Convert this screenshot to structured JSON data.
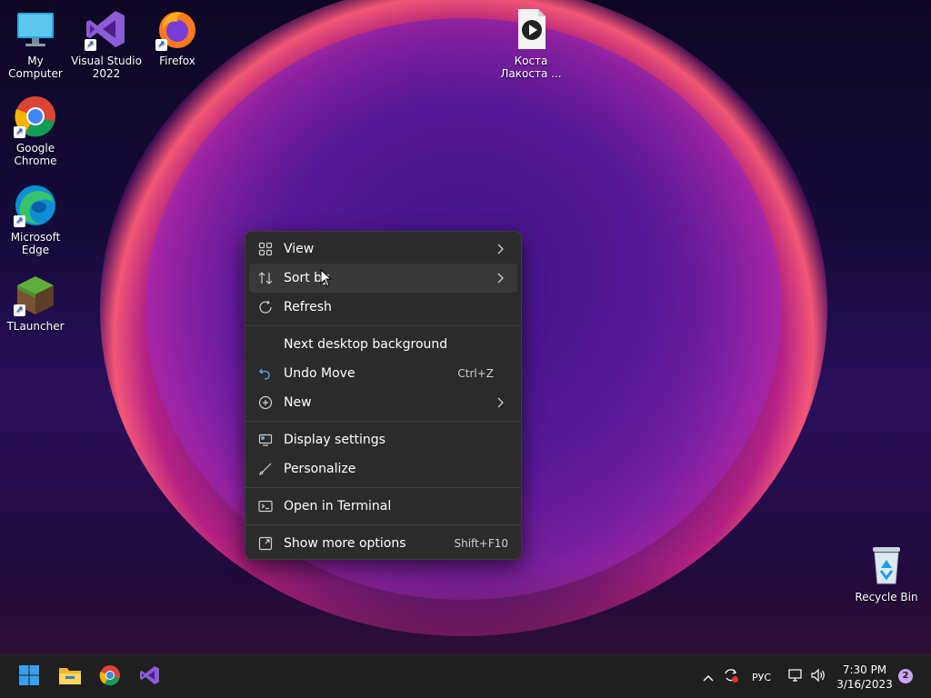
{
  "desktop": {
    "icons": [
      {
        "label": "My Computer",
        "icon": "monitor-icon"
      },
      {
        "label": "Visual Studio 2022",
        "icon": "visual-studio-icon"
      },
      {
        "label": "Firefox",
        "icon": "firefox-icon"
      },
      {
        "label": "Коста Лакоста ...",
        "icon": "media-file-icon"
      },
      {
        "label": "Google Chrome",
        "icon": "chrome-icon"
      },
      {
        "label": "Microsoft Edge",
        "icon": "edge-icon"
      },
      {
        "label": "TLauncher",
        "icon": "minecraft-block-icon"
      },
      {
        "label": "Recycle Bin",
        "icon": "recycle-bin-icon"
      }
    ]
  },
  "context_menu": {
    "items": [
      {
        "label": "View",
        "icon": "grid-icon",
        "submenu": true
      },
      {
        "label": "Sort by",
        "icon": "sort-icon",
        "submenu": true,
        "hovered": true
      },
      {
        "label": "Refresh",
        "icon": "refresh-icon"
      },
      {
        "label": "Next desktop background",
        "icon": ""
      },
      {
        "label": "Undo Move",
        "icon": "undo-icon",
        "shortcut": "Ctrl+Z"
      },
      {
        "label": "New",
        "icon": "plus-circle-icon",
        "submenu": true
      },
      {
        "label": "Display settings",
        "icon": "display-icon"
      },
      {
        "label": "Personalize",
        "icon": "brush-icon"
      },
      {
        "label": "Open in Terminal",
        "icon": "terminal-icon"
      },
      {
        "label": "Show more options",
        "icon": "expand-icon",
        "shortcut": "Shift+F10"
      }
    ]
  },
  "taskbar": {
    "pinned": [
      "start-icon",
      "file-explorer-icon",
      "chrome-icon",
      "visual-studio-icon"
    ],
    "tray": {
      "language": "РУС",
      "time": "7:30 PM",
      "date": "3/16/2023",
      "notifications": "2"
    }
  },
  "colors": {
    "menu_bg": "#2b2b2b",
    "menu_hover": "#383838",
    "taskbar_bg": "#1f1f1f",
    "accent": "#0078d4"
  }
}
